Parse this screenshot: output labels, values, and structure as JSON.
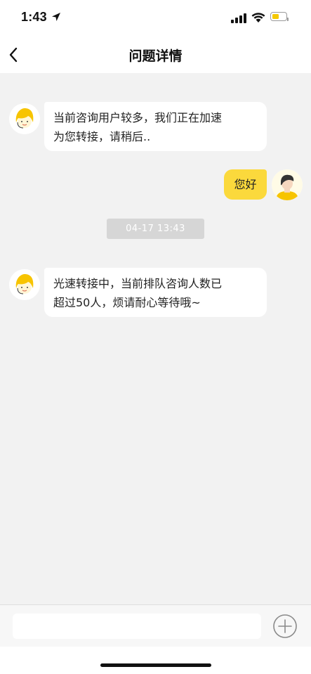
{
  "status_bar": {
    "time": "1:43",
    "icons": [
      "location-arrow-icon",
      "signal-icon",
      "wifi-icon",
      "battery-icon"
    ],
    "battery_color": "#f4c800"
  },
  "nav": {
    "back_icon": "chevron-left-icon",
    "title": "问题详情"
  },
  "messages": [
    {
      "sender": "agent",
      "avatar_icon": "service-agent-avatar",
      "lines": [
        "当前咨询用户较多，我们正在加速",
        "为您转接，请稍后.."
      ]
    },
    {
      "sender": "user",
      "avatar_icon": "user-avatar",
      "lines": [
        "您好"
      ]
    },
    {
      "type": "timestamp",
      "text": "04-17 13:43"
    },
    {
      "sender": "agent",
      "avatar_icon": "service-agent-avatar",
      "lines": [
        "光速转接中，当前排队咨询人数已",
        "超过50人，烦请耐心等待哦~"
      ]
    }
  ],
  "input": {
    "placeholder": "",
    "value": "",
    "plus_icon": "plus-circle-icon"
  },
  "colors": {
    "user_bubble": "#fbd93c",
    "agent_bubble": "#ffffff",
    "background": "#f2f2f2"
  }
}
